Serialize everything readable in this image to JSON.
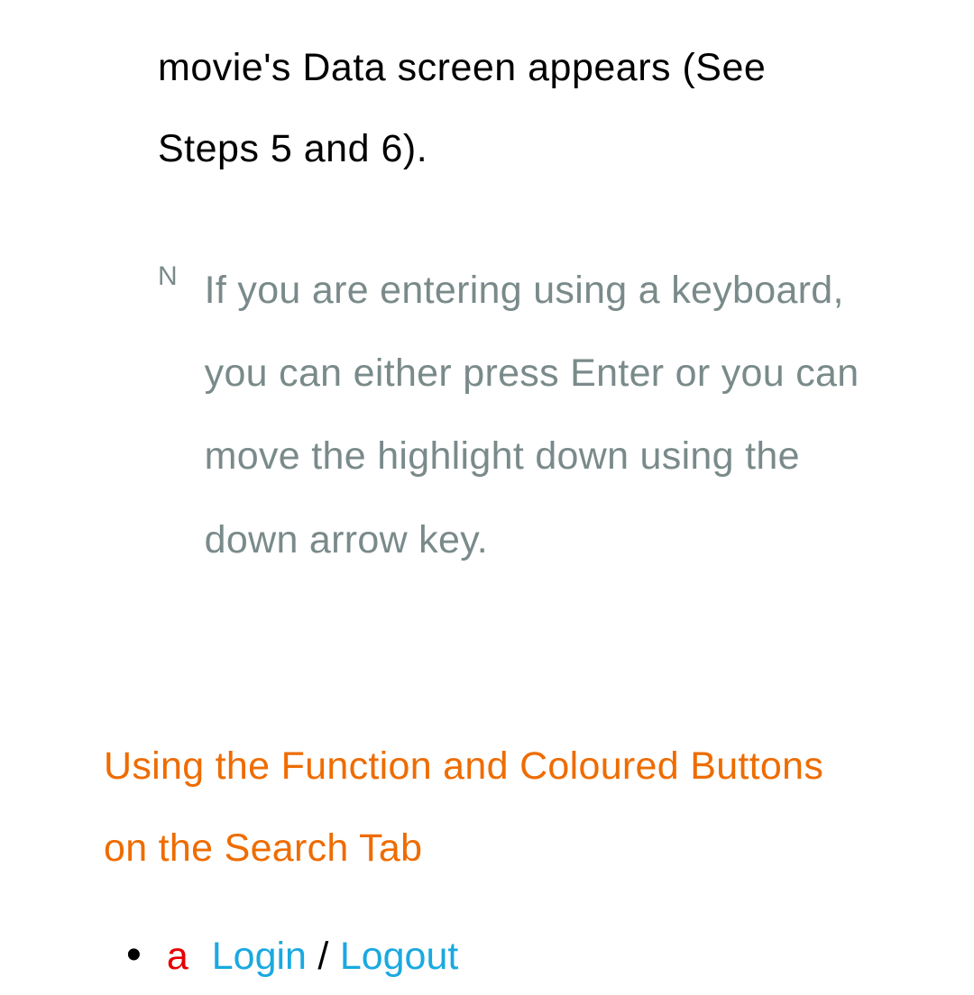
{
  "fragment": "movie's Data screen appears (See Steps 5 and 6).",
  "note": {
    "marker": "N",
    "text": "If you are entering using a keyboard, you can either press Enter or you can move the highlight down using the down arrow key."
  },
  "subheading": "Using the Function and Coloured Buttons on the Search Tab",
  "list": {
    "label": "a",
    "login": "Login",
    "slash": "/",
    "logout": "Logout"
  }
}
